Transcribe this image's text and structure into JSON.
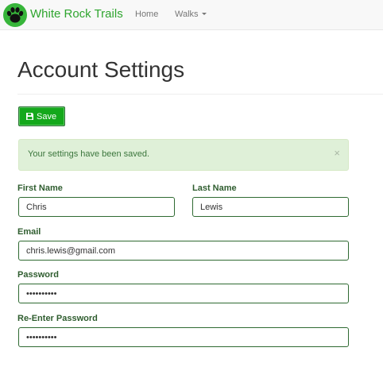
{
  "navbar": {
    "brand_name": "White Rock Trails",
    "logo_icon": "paw-icon",
    "items": [
      {
        "label": "Home"
      },
      {
        "label": "Walks",
        "icon": "caret-down-icon"
      }
    ]
  },
  "page": {
    "title": "Account Settings"
  },
  "toolbar": {
    "save_label": "Save",
    "save_icon": "floppy-disk-icon"
  },
  "alert": {
    "message": "Your settings have been saved.",
    "close_glyph": "×"
  },
  "form": {
    "first_name": {
      "label": "First Name",
      "value": "Chris"
    },
    "last_name": {
      "label": "Last Name",
      "value": "Lewis"
    },
    "email": {
      "label": "Email",
      "value": "chris.lewis@gmail.com"
    },
    "password": {
      "label": "Password",
      "value": "••••••••••"
    },
    "reenter_password": {
      "label": "Re-Enter Password",
      "value": "••••••••••"
    }
  },
  "colors": {
    "brand": "#2fa52f",
    "logo_bg": "#37b53a",
    "primary_button": "#14a81b",
    "alert_bg": "#dff0d8",
    "alert_text": "#3c763d",
    "label_text": "#2f5d2f",
    "input_border": "#2f6a32"
  }
}
